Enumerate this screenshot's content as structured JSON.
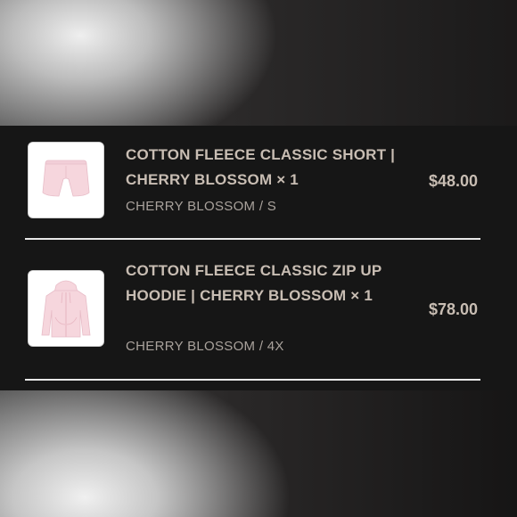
{
  "cart": {
    "items": [
      {
        "title": "COTTON FLEECE CLASSIC SHORT | CHERRY BLOSSOM × 1",
        "variant": "CHERRY BLOSSOM / S",
        "price": "$48.00",
        "image_icon": "pink-shorts-icon"
      },
      {
        "title": "COTTON FLEECE CLASSIC ZIP UP HOODIE | CHERRY BLOSSOM × 1",
        "variant": "CHERRY BLOSSOM / 4X",
        "price": "$78.00",
        "image_icon": "pink-hoodie-icon"
      }
    ]
  },
  "colors": {
    "panel_bg": "#161616",
    "text_primary": "#c8bdb3",
    "text_secondary": "#a9a29c",
    "product_pink": "#f6d6dd",
    "divider": "#e8e8e8"
  }
}
